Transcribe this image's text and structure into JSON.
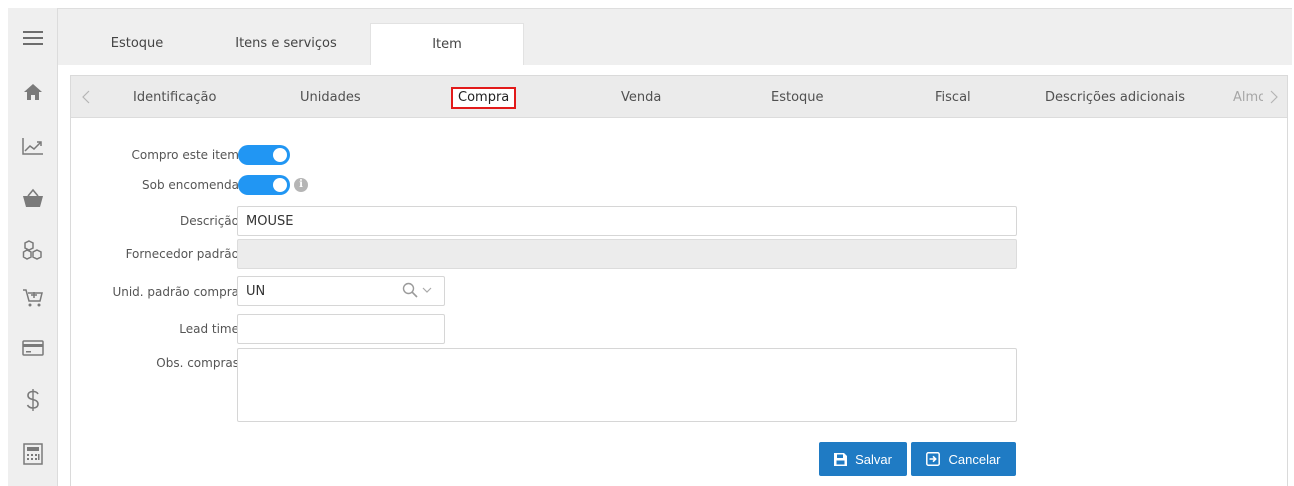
{
  "top_tabs": [
    {
      "label": "Estoque"
    },
    {
      "label": "Itens e serviços"
    },
    {
      "label": "Item"
    }
  ],
  "sub_tabs": [
    {
      "label": "Identificação"
    },
    {
      "label": "Unidades"
    },
    {
      "label": "Compra"
    },
    {
      "label": "Venda"
    },
    {
      "label": "Estoque"
    },
    {
      "label": "Fiscal"
    },
    {
      "label": "Descrições adicionais"
    },
    {
      "label": "Almo"
    }
  ],
  "active_sub_tab": "Compra",
  "form": {
    "compro_label": "Compro este item",
    "compro_on": true,
    "encomenda_label": "Sob encomenda",
    "encomenda_on": true,
    "info_glyph": "i",
    "descricao_label": "Descrição",
    "descricao_value": "MOUSE",
    "fornecedor_label": "Fornecedor padrão",
    "fornecedor_value": "",
    "unid_label": "Unid. padrão compra",
    "unid_value": "UN",
    "lead_label": "Lead time",
    "lead_value": "",
    "obs_label": "Obs. compras",
    "obs_value": ""
  },
  "actions": {
    "save_label": "Salvar",
    "cancel_label": "Cancelar"
  },
  "sidebar_icons": [
    "menu-icon",
    "home-icon",
    "chart-icon",
    "basket-icon",
    "boxes-icon",
    "cart-icon",
    "card-icon",
    "dollar-icon",
    "calculator-icon"
  ],
  "colors": {
    "toggle_on": "#2196f3",
    "button": "#1f7bc4",
    "active_highlight": "#e21a1a"
  }
}
